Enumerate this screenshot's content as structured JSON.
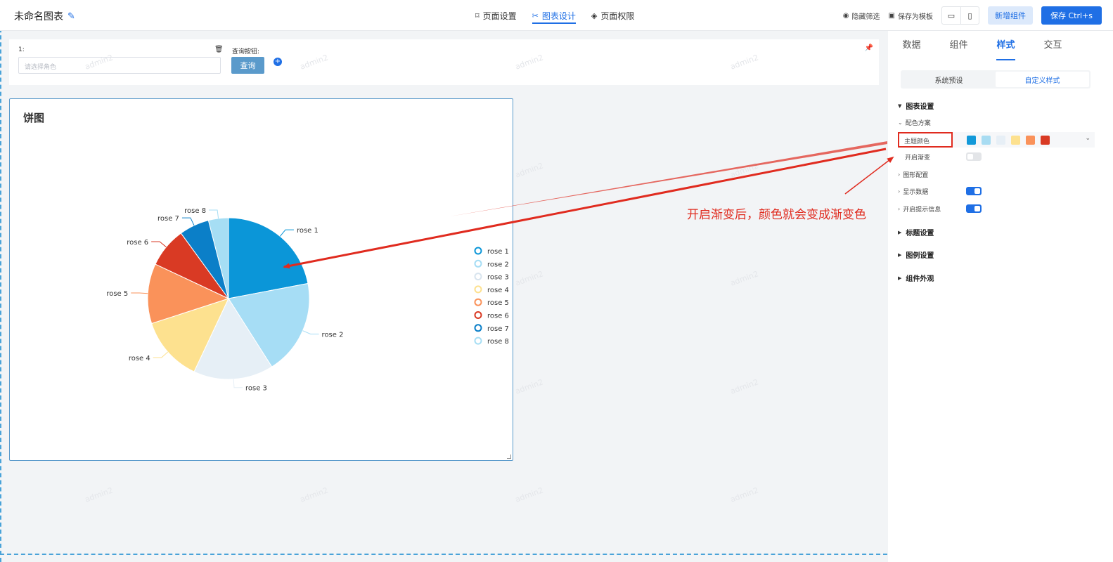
{
  "header": {
    "chart_name": "未命名图表",
    "nav_tabs": [
      {
        "label": "页面设置",
        "active": false
      },
      {
        "label": "图表设计",
        "active": true
      },
      {
        "label": "页面权限",
        "active": false
      }
    ],
    "hide_filter_label": "隐藏筛选",
    "save_template_label": "保存为模板",
    "add_component_label": "新增组件",
    "save_label": "保存 Ctrl+s"
  },
  "filter": {
    "field_label": "1:",
    "select_placeholder": "请选择角色",
    "query_label": "查询按钮:",
    "query_button": "查询"
  },
  "watermark": "admin2",
  "chart_card": {
    "title": "饼图"
  },
  "chart_data": {
    "type": "pie",
    "categories": [
      "rose 1",
      "rose 2",
      "rose 3",
      "rose 4",
      "rose 5",
      "rose 6",
      "rose 7",
      "rose 8"
    ],
    "values": [
      22,
      19,
      16,
      13,
      12,
      8,
      6,
      4
    ],
    "colors": [
      "#0b96d8",
      "#a6ddf5",
      "#e6eff6",
      "#fde18f",
      "#fa925a",
      "#d93a24",
      "#0b7fc8",
      "#a6def4"
    ],
    "legend_position": "right",
    "legend": [
      "rose 1",
      "rose 2",
      "rose 3",
      "rose 4",
      "rose 5",
      "rose 6",
      "rose 7",
      "rose 8"
    ]
  },
  "right_panel": {
    "tabs": [
      {
        "label": "数据",
        "active": false
      },
      {
        "label": "组件",
        "active": false
      },
      {
        "label": "样式",
        "active": true
      },
      {
        "label": "交互",
        "active": false
      }
    ],
    "segment": {
      "preset": "系统预设",
      "custom": "自定义样式"
    },
    "chart_settings": "图表设置",
    "color_scheme": "配色方案",
    "theme_color_label": "主题颜色",
    "theme_swatches": [
      "#1299d9",
      "#a8dcf2",
      "#e7eff6",
      "#fde18f",
      "#fa925a",
      "#d93a24"
    ],
    "gradient_label": "开启渐变",
    "gradient_on": false,
    "shape_config": "图形配置",
    "show_data": "显示数据",
    "show_data_on": true,
    "tooltip": "开启提示信息",
    "tooltip_on": true,
    "title_settings": "标题设置",
    "legend_settings": "图例设置",
    "component_appearance": "组件外观"
  },
  "annotation": {
    "text": "开启渐变后，颜色就会变成渐变色",
    "color": "#e02b1f"
  }
}
